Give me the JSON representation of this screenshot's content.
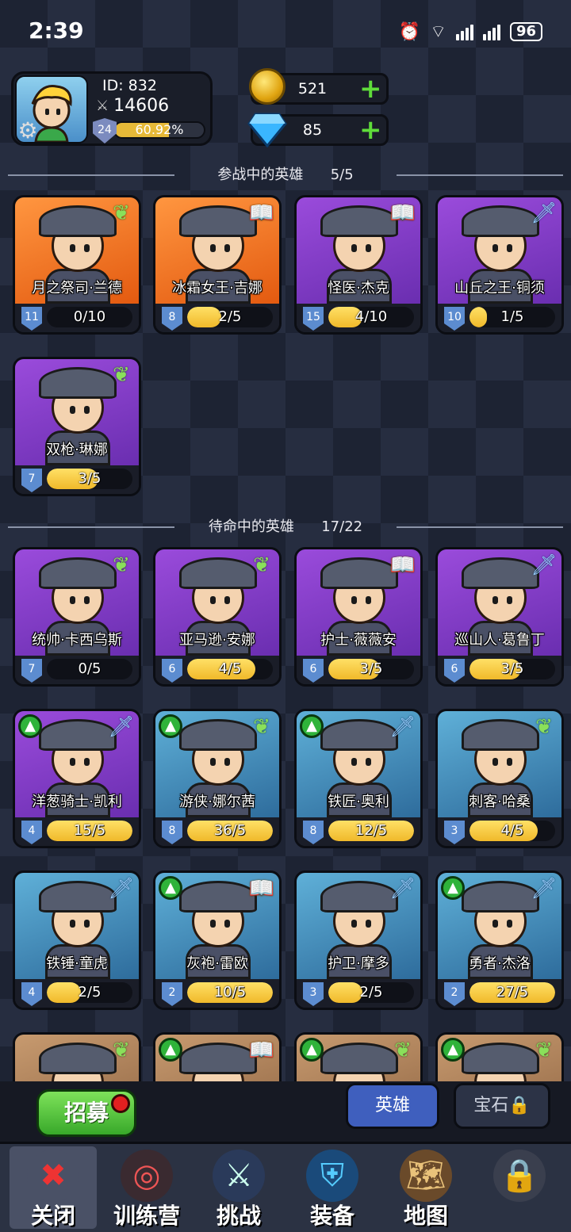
{
  "status_bar": {
    "time": "2:39",
    "battery": "96"
  },
  "profile": {
    "id_label": "ID: 832",
    "power": "14606",
    "level": "24",
    "level_pct": "60.92%",
    "level_fraction": 0.6092
  },
  "currency": {
    "gold": "521",
    "gems": "85"
  },
  "active_section": {
    "title": "参战中的英雄",
    "count": "5/5"
  },
  "reserve_section": {
    "title": "待命中的英雄",
    "count": "17/22"
  },
  "active_heroes": [
    {
      "name": "月之祭司·兰德",
      "level": "11",
      "progress": "0/10",
      "ratio": 0.0,
      "theme": "orange",
      "badge": "wing",
      "upgrade": false
    },
    {
      "name": "冰霜女王·吉娜",
      "level": "8",
      "progress": "2/5",
      "ratio": 0.4,
      "theme": "orange",
      "badge": "book",
      "upgrade": false
    },
    {
      "name": "怪医·杰克",
      "level": "15",
      "progress": "4/10",
      "ratio": 0.4,
      "theme": "purple",
      "badge": "book",
      "upgrade": false
    },
    {
      "name": "山丘之王·铜须",
      "level": "10",
      "progress": "1/5",
      "ratio": 0.2,
      "theme": "purple",
      "badge": "sword",
      "upgrade": false
    },
    {
      "name": "双枪·琳娜",
      "level": "7",
      "progress": "3/5",
      "ratio": 0.6,
      "theme": "purple",
      "badge": "wing",
      "upgrade": false
    }
  ],
  "reserve_heroes": [
    {
      "name": "统帅·卡西乌斯",
      "level": "7",
      "progress": "0/5",
      "ratio": 0.0,
      "theme": "purple",
      "badge": "wing",
      "upgrade": false
    },
    {
      "name": "亚马逊·安娜",
      "level": "6",
      "progress": "4/5",
      "ratio": 0.8,
      "theme": "purple",
      "badge": "wing",
      "upgrade": false
    },
    {
      "name": "护士·薇薇安",
      "level": "6",
      "progress": "3/5",
      "ratio": 0.6,
      "theme": "purple",
      "badge": "book",
      "upgrade": false
    },
    {
      "name": "巡山人·葛鲁丁",
      "level": "6",
      "progress": "3/5",
      "ratio": 0.6,
      "theme": "purple",
      "badge": "sword",
      "upgrade": false
    },
    {
      "name": "洋葱骑士·凯利",
      "level": "4",
      "progress": "15/5",
      "ratio": 1.0,
      "theme": "purple",
      "badge": "sword",
      "upgrade": true
    },
    {
      "name": "游侠·娜尔茜",
      "level": "8",
      "progress": "36/5",
      "ratio": 1.0,
      "theme": "blue",
      "badge": "wing",
      "upgrade": true
    },
    {
      "name": "铁匠·奥利",
      "level": "8",
      "progress": "12/5",
      "ratio": 1.0,
      "theme": "blue",
      "badge": "sword",
      "upgrade": true
    },
    {
      "name": "刺客·哈桑",
      "level": "3",
      "progress": "4/5",
      "ratio": 0.8,
      "theme": "blue",
      "badge": "wing",
      "upgrade": false
    },
    {
      "name": "铁锤·童虎",
      "level": "4",
      "progress": "2/5",
      "ratio": 0.4,
      "theme": "blue",
      "badge": "sword",
      "upgrade": false
    },
    {
      "name": "灰袍·雷欧",
      "level": "2",
      "progress": "10/5",
      "ratio": 1.0,
      "theme": "blue",
      "badge": "book",
      "upgrade": true
    },
    {
      "name": "护卫·摩多",
      "level": "3",
      "progress": "2/5",
      "ratio": 0.4,
      "theme": "blue",
      "badge": "sword",
      "upgrade": false
    },
    {
      "name": "勇者·杰洛",
      "level": "2",
      "progress": "27/5",
      "ratio": 1.0,
      "theme": "blue",
      "badge": "sword",
      "upgrade": true
    },
    {
      "name": "",
      "level": "",
      "progress": "",
      "ratio": 0.0,
      "theme": "tan",
      "badge": "wing",
      "upgrade": false
    },
    {
      "name": "",
      "level": "",
      "progress": "",
      "ratio": 0.0,
      "theme": "tan",
      "badge": "book",
      "upgrade": true
    },
    {
      "name": "",
      "level": "",
      "progress": "",
      "ratio": 0.0,
      "theme": "tan",
      "badge": "wing",
      "upgrade": true
    },
    {
      "name": "",
      "level": "",
      "progress": "",
      "ratio": 0.0,
      "theme": "tan",
      "badge": "wing",
      "upgrade": true
    }
  ],
  "bottom": {
    "recruit": "招募",
    "tab_hero": "英雄",
    "tab_locked": "宝石"
  },
  "nav": [
    {
      "label": "关闭",
      "icon": "close-icon"
    },
    {
      "label": "训练营",
      "icon": "target-icon"
    },
    {
      "label": "挑战",
      "icon": "sword-icon"
    },
    {
      "label": "装备",
      "icon": "armor-icon"
    },
    {
      "label": "地图",
      "icon": "map-icon"
    },
    {
      "label": "",
      "icon": "lock-icon"
    }
  ]
}
